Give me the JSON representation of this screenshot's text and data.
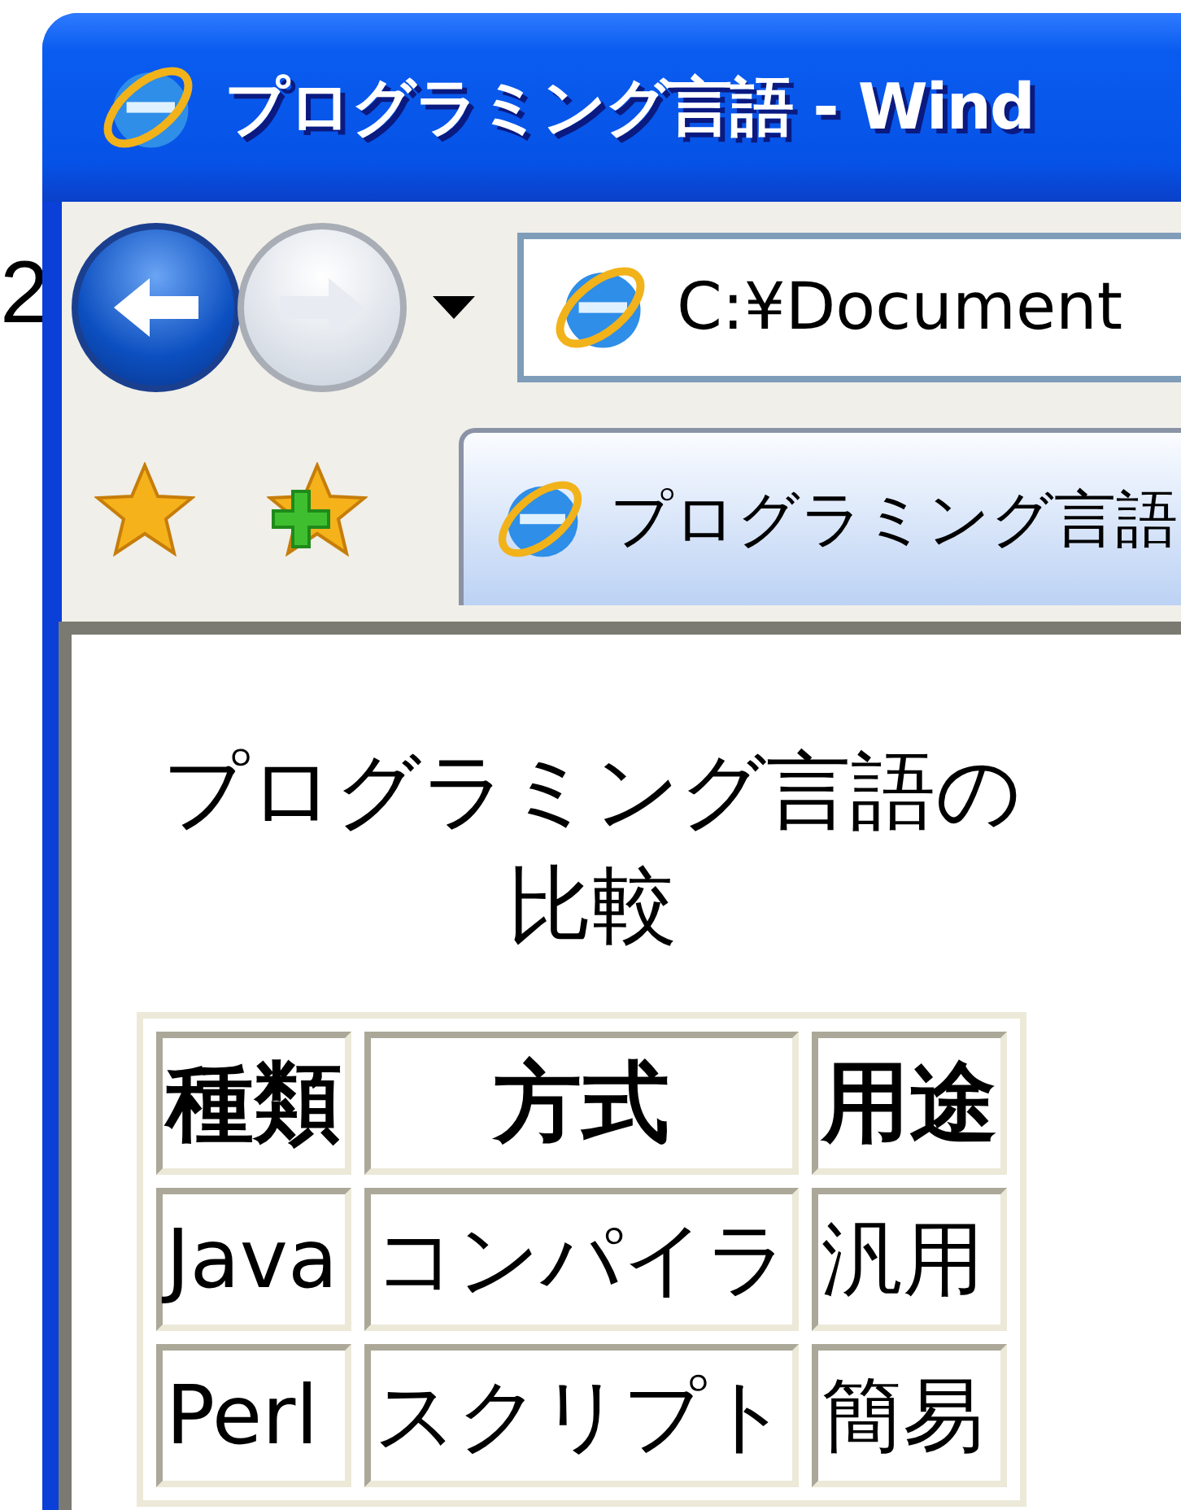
{
  "background": {
    "text": "2"
  },
  "window": {
    "title": "プログラミング言語 - Wind"
  },
  "navigation": [
    {
      "kind": "back",
      "disabled": false
    },
    {
      "kind": "forward",
      "disabled": true
    }
  ],
  "address_bar": {
    "value": "C:¥Document"
  },
  "tab": {
    "label": "プログラミング言語",
    "selected": true
  },
  "page": {
    "heading": "プログラミング言語の比較"
  },
  "table": {
    "columns": [
      "種類",
      "方式",
      "用途"
    ],
    "rows": [
      [
        "Java",
        "コンパイラ",
        "汎用"
      ],
      [
        "Perl",
        "スクリプト",
        "簡易"
      ]
    ]
  }
}
